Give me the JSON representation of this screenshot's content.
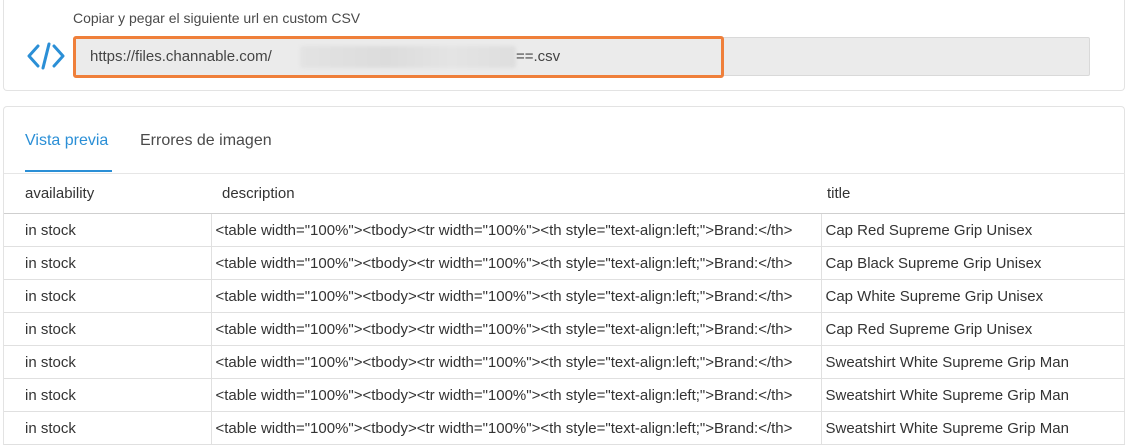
{
  "url_section": {
    "label": "Copiar y pegar el siguiente url en custom CSV",
    "url_prefix": "https://files.channable.com/",
    "url_suffix": "==.csv",
    "icon": "code-icon",
    "accent_color": "#2b8fd6",
    "highlight_color": "#ef7f3a"
  },
  "tabs": [
    {
      "label": "Vista previa",
      "active": true
    },
    {
      "label": "Errores de imagen",
      "active": false
    }
  ],
  "table": {
    "columns": [
      "availability",
      "description",
      "title"
    ],
    "rows": [
      {
        "availability": "in stock",
        "description": "<table width=\"100%\"><tbody><tr width=\"100%\"><th style=\"text-align:left;\">Brand:</th>",
        "title": "Cap Red Supreme Grip Unisex"
      },
      {
        "availability": "in stock",
        "description": "<table width=\"100%\"><tbody><tr width=\"100%\"><th style=\"text-align:left;\">Brand:</th>",
        "title": "Cap Black Supreme Grip Unisex"
      },
      {
        "availability": "in stock",
        "description": "<table width=\"100%\"><tbody><tr width=\"100%\"><th style=\"text-align:left;\">Brand:</th>",
        "title": "Cap White Supreme Grip Unisex"
      },
      {
        "availability": "in stock",
        "description": "<table width=\"100%\"><tbody><tr width=\"100%\"><th style=\"text-align:left;\">Brand:</th>",
        "title": "Cap Red Supreme Grip Unisex"
      },
      {
        "availability": "in stock",
        "description": "<table width=\"100%\"><tbody><tr width=\"100%\"><th style=\"text-align:left;\">Brand:</th>",
        "title": "Sweatshirt White Supreme Grip Man"
      },
      {
        "availability": "in stock",
        "description": "<table width=\"100%\"><tbody><tr width=\"100%\"><th style=\"text-align:left;\">Brand:</th>",
        "title": "Sweatshirt White Supreme Grip Man"
      },
      {
        "availability": "in stock",
        "description": "<table width=\"100%\"><tbody><tr width=\"100%\"><th style=\"text-align:left;\">Brand:</th>",
        "title": "Sweatshirt White Supreme Grip Man"
      }
    ]
  }
}
